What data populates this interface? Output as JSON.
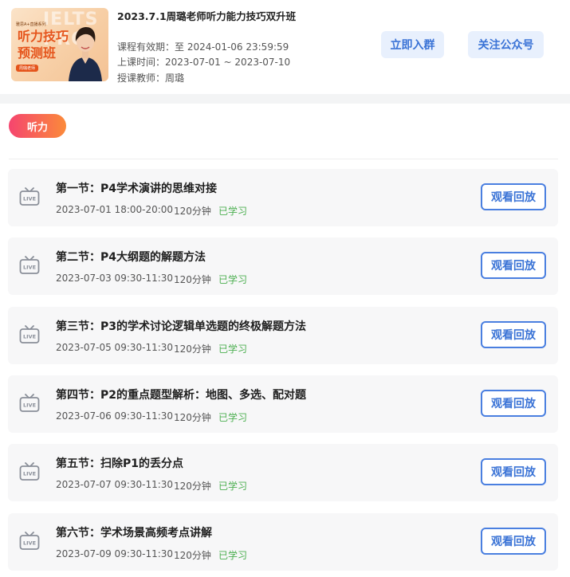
{
  "course": {
    "cover": {
      "watermark": "IELTS PRO",
      "series": "雅思A+直播系列",
      "title_line1": "听力技巧",
      "title_line2": "预测班",
      "teacher_tag": "周璐老师"
    },
    "title": "2023.7.1周璐老师听力能力技巧双升班",
    "validity": "课程有效期：至 2024-01-06 23:59:59",
    "class_time": "上课时间：2023-07-01 ~ 2023-07-10",
    "teacher": "授课教师：周璐"
  },
  "actions": {
    "join_group": "立即入群",
    "follow_account": "关注公众号"
  },
  "section_tag": "听力",
  "colors": {
    "accent_blue": "#3a73d6",
    "tag_gradient_start": "#f5456f",
    "tag_gradient_end": "#fb8a3a",
    "status_green": "#4caf50"
  },
  "lessons": [
    {
      "title": "第一节：P4学术演讲的思维对接",
      "time": "2023-07-01 18:00-20:00",
      "duration": "120分钟",
      "status": "已学习",
      "action": "观看回放",
      "icon": "live-tv-icon"
    },
    {
      "title": "第二节：P4大纲题的解题方法",
      "time": "2023-07-03 09:30-11:30",
      "duration": "120分钟",
      "status": "已学习",
      "action": "观看回放",
      "icon": "live-tv-icon"
    },
    {
      "title": "第三节：P3的学术讨论逻辑单选题的终极解题方法",
      "time": "2023-07-05 09:30-11:30",
      "duration": "120分钟",
      "status": "已学习",
      "action": "观看回放",
      "icon": "live-tv-icon"
    },
    {
      "title": "第四节：P2的重点题型解析：地图、多选、配对题",
      "time": "2023-07-06 09:30-11:30",
      "duration": "120分钟",
      "status": "已学习",
      "action": "观看回放",
      "icon": "live-tv-icon"
    },
    {
      "title": "第五节：扫除P1的丢分点",
      "time": "2023-07-07 09:30-11:30",
      "duration": "120分钟",
      "status": "已学习",
      "action": "观看回放",
      "icon": "live-tv-icon"
    },
    {
      "title": "第六节：学术场景高频考点讲解",
      "time": "2023-07-09 09:30-11:30",
      "duration": "120分钟",
      "status": "已学习",
      "action": "观看回放",
      "icon": "live-tv-icon"
    }
  ]
}
